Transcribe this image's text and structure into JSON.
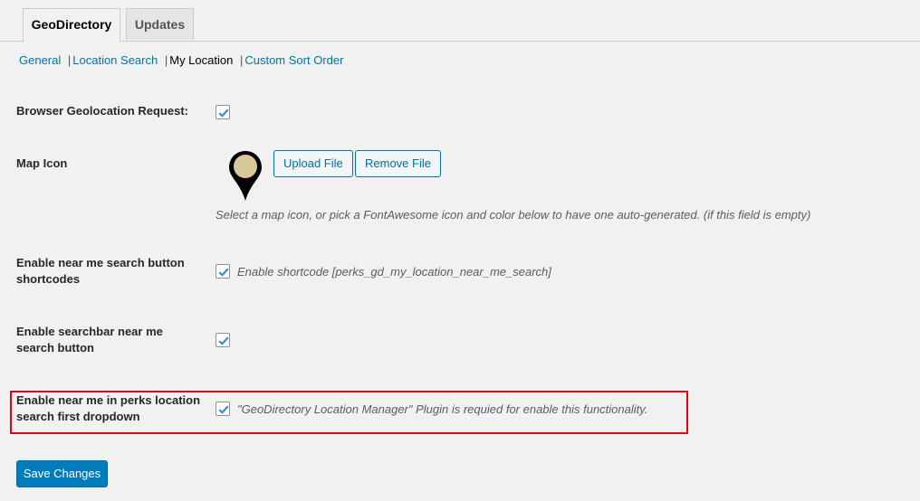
{
  "tabs": [
    {
      "label": "GeoDirectory",
      "active": true
    },
    {
      "label": "Updates",
      "active": false
    }
  ],
  "subnav": {
    "items": [
      "General",
      "Location Search",
      "My Location",
      "Custom Sort Order"
    ],
    "current": "My Location",
    "separator": "|"
  },
  "settings": {
    "browser_geolocation": {
      "label": "Browser Geolocation Request:",
      "checked": true
    },
    "map_icon": {
      "label": "Map Icon",
      "upload_label": "Upload File",
      "remove_label": "Remove File",
      "description": "Select a map icon, or pick a FontAwesome icon and color below to have one auto-generated. (if this field is empty)"
    },
    "near_me_shortcodes": {
      "label": "Enable near me search button shortcodes",
      "checked": true,
      "description": "Enable shortcode [perks_gd_my_location_near_me_search]"
    },
    "searchbar_near_me": {
      "label": "Enable searchbar near me search button",
      "checked": true
    },
    "near_me_perks_dropdown": {
      "label": "Enable near me in perks location search first dropdown",
      "checked": true,
      "description": "\"GeoDirectory Location Manager\" Plugin is requied for enable this functionality."
    }
  },
  "save_label": "Save Changes",
  "colors": {
    "link": "#0073aa",
    "primary": "#007cba",
    "highlight": "#e3000f",
    "background": "#f1f1f1"
  },
  "icons": [
    "map-pin-icon",
    "checkmark-icon"
  ]
}
